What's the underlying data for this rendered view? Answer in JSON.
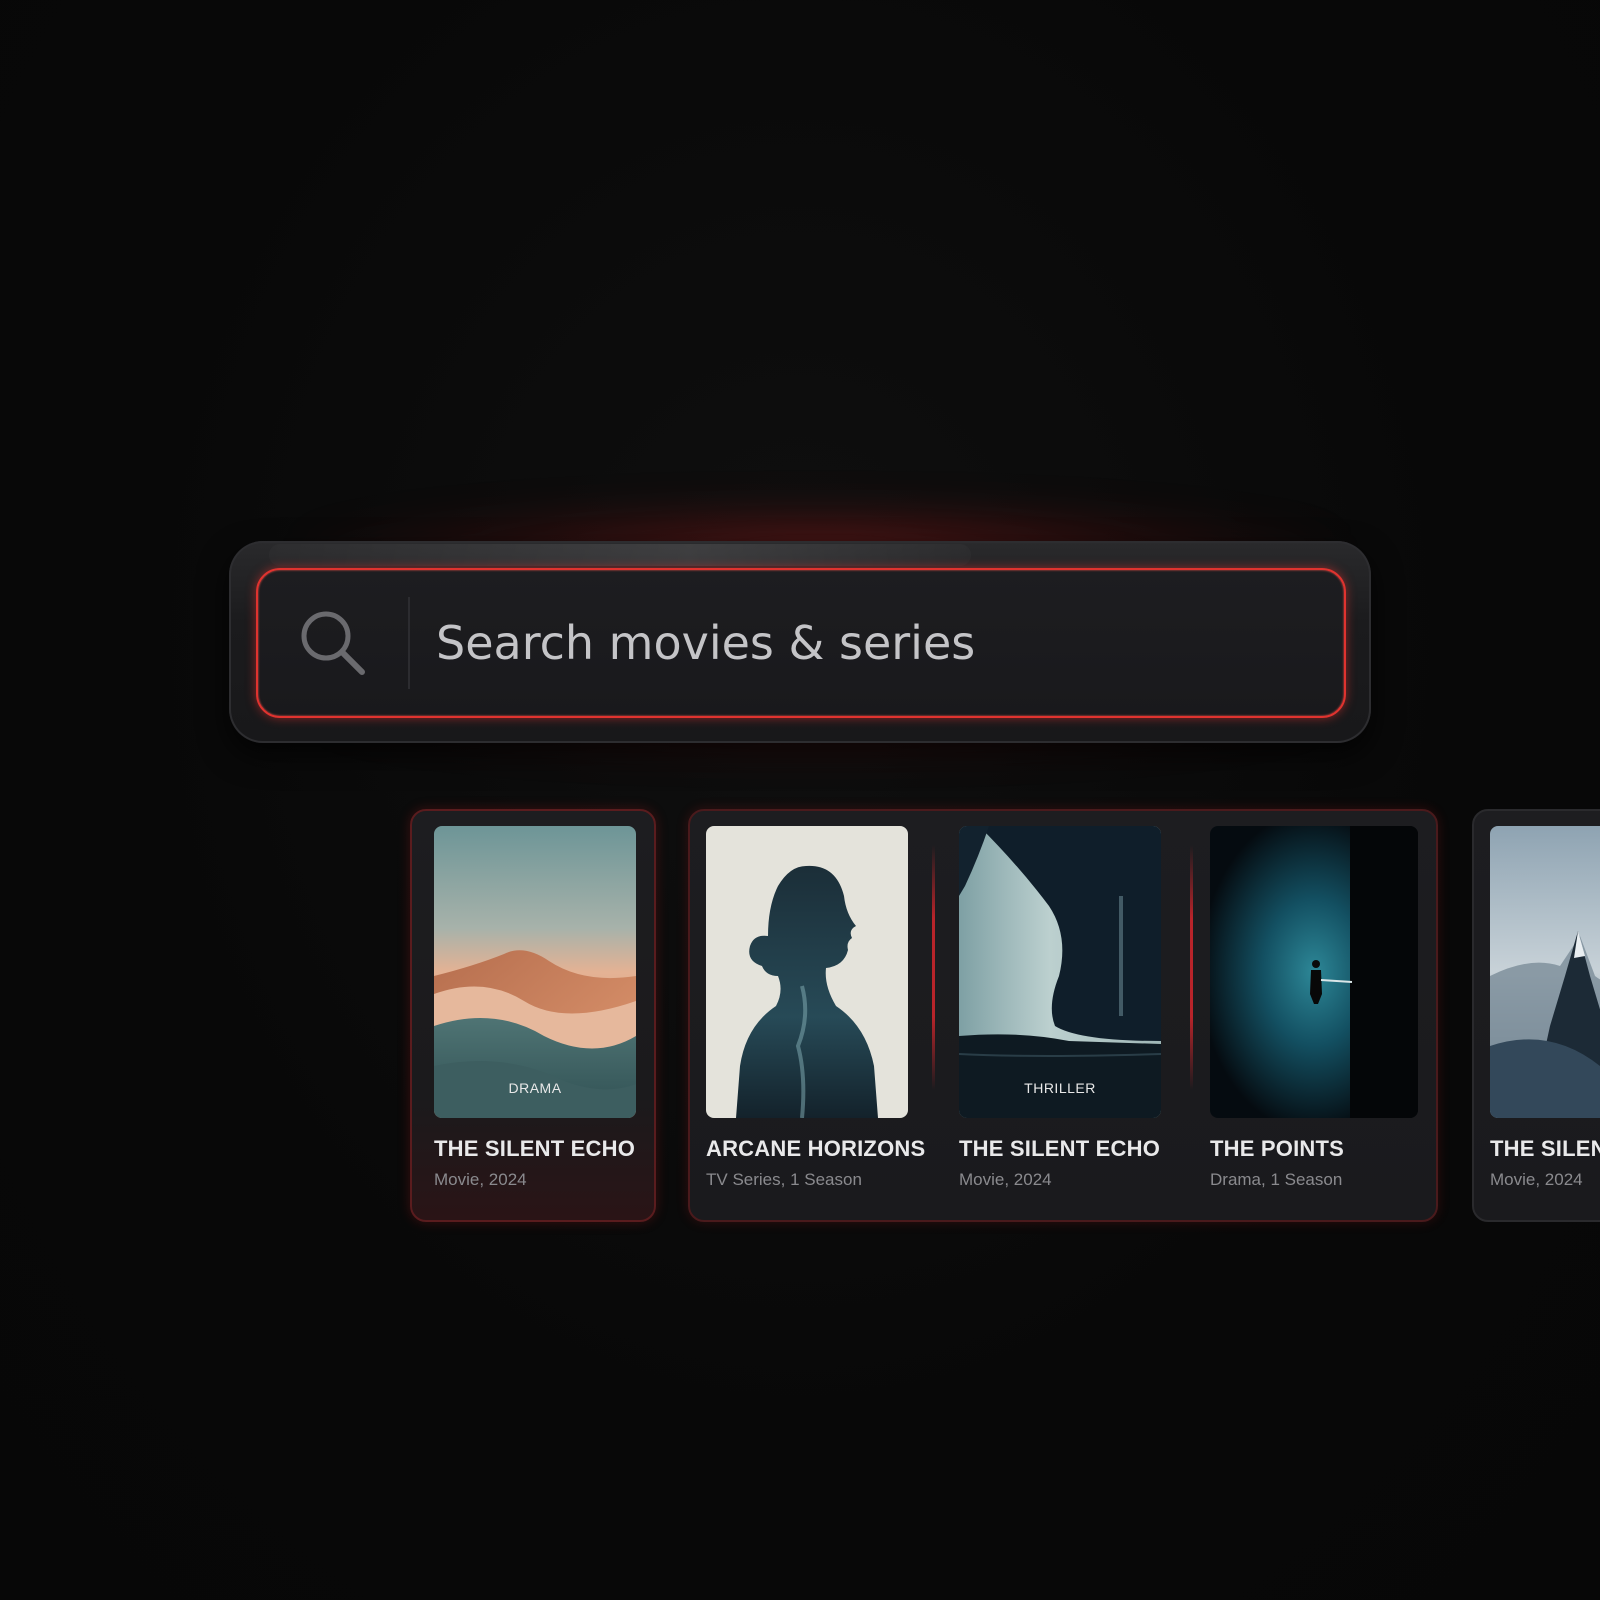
{
  "search": {
    "placeholder": "Search movies & series",
    "icon": "search-icon",
    "accent_color": "#e0332f"
  },
  "results": [
    {
      "title": "THE SILENT ECHO",
      "meta": "Movie,  2024",
      "genre": "DRAMA"
    },
    {
      "title": "ARCANE HORIZONS",
      "meta": "TV Series,  1 Season",
      "genre": ""
    },
    {
      "title": "THE SILENT ECHO",
      "meta": "Movie,  2024",
      "genre": "THRILLER"
    },
    {
      "title": "THE POINTS",
      "meta": "Drama,  1 Season",
      "genre": ""
    },
    {
      "title": "THE SILENT ECHO",
      "meta": "Movie,  2024",
      "genre": ""
    }
  ]
}
